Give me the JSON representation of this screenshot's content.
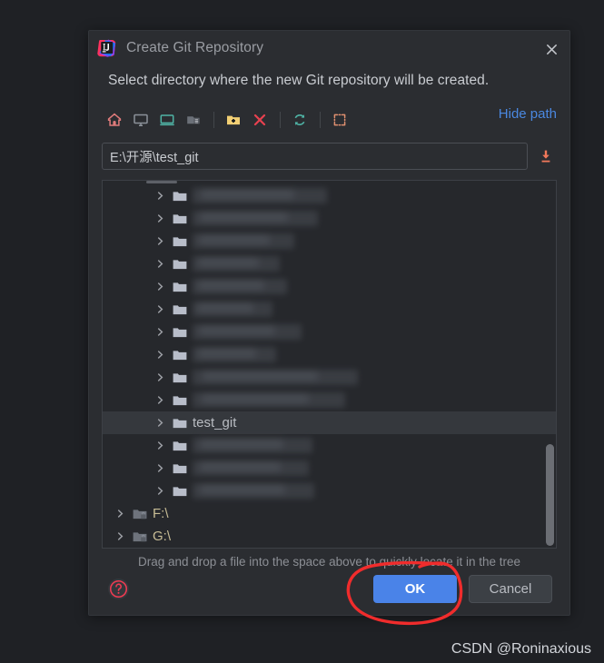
{
  "window": {
    "title": "Create Git Repository",
    "app_icon": "intellij-idea-icon",
    "close_icon": "close-icon"
  },
  "subtitle": "Select directory where the new Git repository will be created.",
  "toolbar": {
    "hide_path_label": "Hide path",
    "buttons": [
      {
        "name": "home-icon",
        "tooltip": "Home"
      },
      {
        "name": "desktop-icon",
        "tooltip": "Desktop"
      },
      {
        "name": "project-icon",
        "tooltip": "Project"
      },
      {
        "name": "module-icon",
        "tooltip": "Module"
      },
      {
        "name": "new-folder-icon",
        "tooltip": "New Folder"
      },
      {
        "name": "delete-icon",
        "tooltip": "Delete"
      },
      {
        "name": "refresh-icon",
        "tooltip": "Refresh"
      },
      {
        "name": "show-hidden-icon",
        "tooltip": "Show Hidden Files"
      }
    ]
  },
  "path": {
    "value": "E:\\开源\\test_git",
    "placeholder": "",
    "download_icon": "download-into-icon"
  },
  "tree": {
    "rows": [
      {
        "label": "",
        "redacted": true,
        "level": 1,
        "smudge_w": 148,
        "smudge_x": 0
      },
      {
        "label": "",
        "redacted": true,
        "level": 1,
        "smudge_w": 138,
        "smudge_x": 0
      },
      {
        "label": "",
        "redacted": true,
        "level": 1,
        "smudge_w": 112,
        "smudge_x": 0
      },
      {
        "label": "",
        "redacted": true,
        "level": 1,
        "smudge_w": 96,
        "smudge_x": 0
      },
      {
        "label": "",
        "redacted": true,
        "level": 1,
        "smudge_w": 104,
        "smudge_x": 0
      },
      {
        "label": "",
        "redacted": true,
        "level": 1,
        "smudge_w": 88,
        "smudge_x": 0
      },
      {
        "label": "",
        "redacted": true,
        "level": 1,
        "smudge_w": 120,
        "smudge_x": 0
      },
      {
        "label": "",
        "redacted": true,
        "level": 1,
        "smudge_w": 92,
        "smudge_x": 0
      },
      {
        "label": "",
        "redacted": true,
        "level": 1,
        "smudge_w": 182,
        "smudge_x": 0
      },
      {
        "label": "",
        "redacted": true,
        "level": 1,
        "smudge_w": 168,
        "smudge_x": 0
      },
      {
        "label": "test_git",
        "redacted": false,
        "selected": true,
        "level": 1
      },
      {
        "label": "",
        "redacted": true,
        "level": 1,
        "smudge_w": 132,
        "smudge_x": 0
      },
      {
        "label": "",
        "redacted": true,
        "level": 1,
        "smudge_w": 128,
        "smudge_x": 0
      },
      {
        "label": "",
        "redacted": true,
        "level": 1,
        "smudge_w": 134,
        "smudge_x": 0
      },
      {
        "label": "F:\\",
        "redacted": false,
        "level": 0,
        "drive": true
      },
      {
        "label": "G:\\",
        "redacted": false,
        "level": 0,
        "drive": true
      }
    ],
    "selected_label": "test_git"
  },
  "hint": "Drag and drop a file into the space above to quickly locate it in the tree",
  "footer": {
    "help_icon": "help-circle-icon",
    "ok_label": "OK",
    "cancel_label": "Cancel"
  },
  "annotation": {
    "shape": "hand-drawn-red-circle",
    "target": "OK",
    "color": "#f02c2c"
  },
  "watermark": "CSDN @Roninaxious",
  "colors": {
    "dialog_bg": "#2b2d31",
    "page_bg": "#1f2125",
    "accent_blue": "#4a83e8",
    "link_blue": "#4a88e0",
    "selection": "#35383d",
    "folder": "#b8bdc9",
    "drive_label": "#c8bd96",
    "download_orange": "#f0785a",
    "help_red": "#ef3b52",
    "annotation_red": "#f02c2c"
  }
}
